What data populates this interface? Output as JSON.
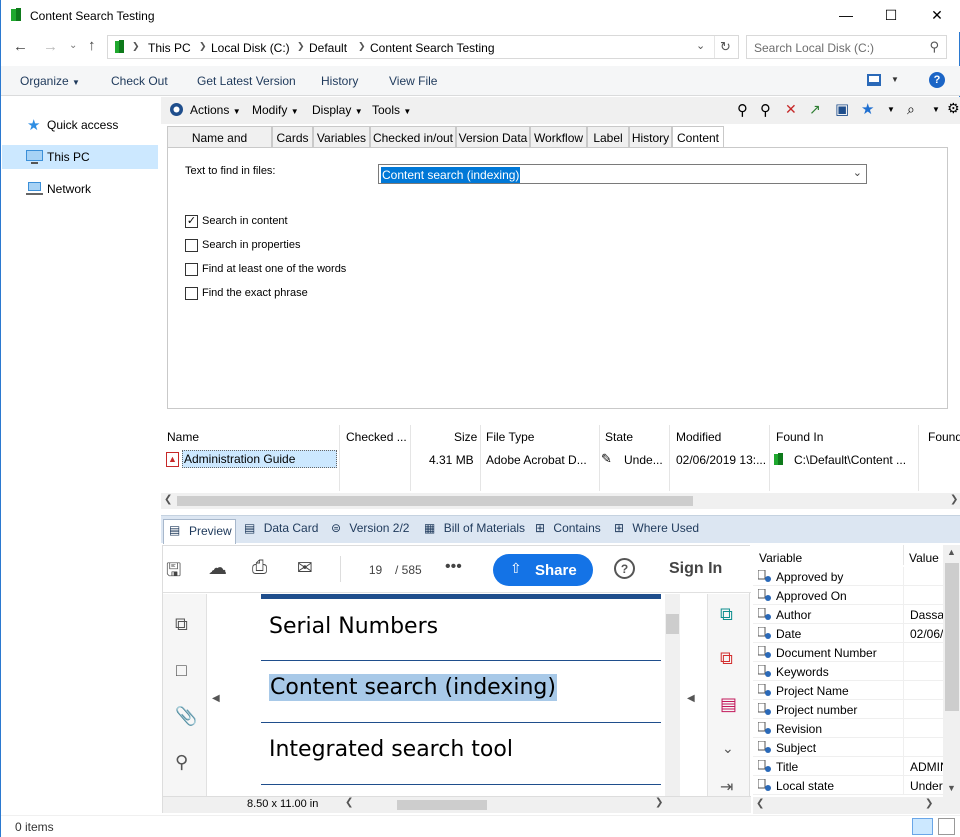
{
  "window": {
    "title": "Content Search Testing"
  },
  "address": {
    "crumbs": [
      "This PC",
      "Local Disk (C:)",
      "Default",
      "Content Search Testing"
    ],
    "search_placeholder": "Search Local Disk (C:)"
  },
  "commands": [
    "Organize",
    "Check Out",
    "Get Latest Version",
    "History",
    "View File"
  ],
  "nav": [
    {
      "label": "Quick access",
      "icon": "star-icon"
    },
    {
      "label": "This PC",
      "icon": "computer-icon",
      "selected": true
    },
    {
      "label": "Network",
      "icon": "network-icon"
    }
  ],
  "menubar": [
    "Actions",
    "Modify",
    "Display",
    "Tools"
  ],
  "tabs": [
    "Name and Location",
    "Cards",
    "Variables",
    "Checked in/out",
    "Version Data",
    "Workflow",
    "Label",
    "History",
    "Content"
  ],
  "search": {
    "text_label": "Text to find in files:",
    "text_value": "Content search (indexing)",
    "options": [
      {
        "label": "Search in content",
        "checked": true
      },
      {
        "label": "Search in properties",
        "checked": false
      },
      {
        "label": "Find at least one of the words",
        "checked": false
      },
      {
        "label": "Find the exact phrase",
        "checked": false
      }
    ]
  },
  "results": {
    "columns": [
      "Name",
      "Checked ...",
      "Size",
      "File Type",
      "State",
      "Modified",
      "Found In",
      "Found"
    ],
    "rows": [
      {
        "name": "Administration Guide",
        "checked": "",
        "size": "4.31 MB",
        "type": "Adobe Acrobat D...",
        "state": "Unde...",
        "modified": "02/06/2019 13:...",
        "found_in": "C:\\Default\\Content ...",
        "found": ""
      }
    ]
  },
  "preview_tabs": [
    "Preview",
    "Data Card",
    "Version 2/2",
    "Bill of Materials",
    "Contains",
    "Where Used"
  ],
  "pdf": {
    "page": "19",
    "total": "/ 585",
    "share_label": "Share",
    "signin_label": "Sign In",
    "headings": [
      "Serial Numbers",
      "Content search (indexing)",
      "Integrated search tool"
    ],
    "page_size": "8.50 x 11.00 in"
  },
  "variables": {
    "columns": [
      "Variable",
      "Value"
    ],
    "rows": [
      {
        "name": "Approved by",
        "value": ""
      },
      {
        "name": "Approved On",
        "value": ""
      },
      {
        "name": "Author",
        "value": "Dassault"
      },
      {
        "name": "Date",
        "value": "02/06/"
      },
      {
        "name": "Document Number",
        "value": ""
      },
      {
        "name": "Keywords",
        "value": ""
      },
      {
        "name": "Project Name",
        "value": ""
      },
      {
        "name": "Project number",
        "value": ""
      },
      {
        "name": "Revision",
        "value": ""
      },
      {
        "name": "Subject",
        "value": ""
      },
      {
        "name": "Title",
        "value": "ADMIN"
      },
      {
        "name": "Local state",
        "value": "Under"
      }
    ]
  },
  "status": {
    "items": "0 items"
  }
}
